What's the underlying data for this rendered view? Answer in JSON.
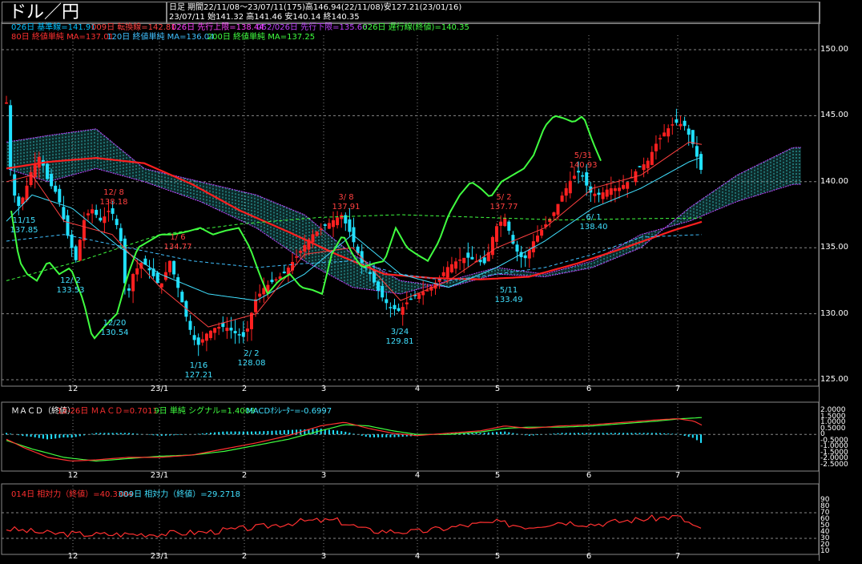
{
  "header": {
    "title": "ドル／円",
    "period_line": "日足  期間22/11/08〜23/07/11(175)高146.94(22/11/08)安127.21(23/01/16)",
    "last_line": "23/07/11          始141.32 高141.46 安140.14 終140.35"
  },
  "legend_row1": [
    {
      "text": "026日 基準線=141.91",
      "color": "#00c0ff"
    },
    {
      "text": "009日 転換線=142.81",
      "color": "#ff4040"
    },
    {
      "text": "026日 先行上限=138.44",
      "color": "#ff40ff"
    },
    {
      "text": "052/026日 先行下限=135.66",
      "color": "#c040ff"
    },
    {
      "text": "026日 遅行線(終値)=140.35",
      "color": "#40ff40"
    }
  ],
  "legend_row2": [
    {
      "text": "80日 終値単純 MA=137.01",
      "color": "#ff3030"
    },
    {
      "text": "120日 終値単純 MA=136.04",
      "color": "#40c0ff"
    },
    {
      "text": "200日 終値単純 MA=137.25",
      "color": "#40ff40"
    }
  ],
  "macd_legend": [
    {
      "text": "ＭＡＣＤ（終値）",
      "color": "#ffffff"
    },
    {
      "text": "12-26日 ＭＡＣＤ=0.7011",
      "color": "#ff3030"
    },
    {
      "text": "9日 単純 シグナル=1.4009",
      "color": "#40ff40"
    },
    {
      "text": "MACDｵｼﾚｰﾀｰ=-0.6997",
      "color": "#40e0ff"
    }
  ],
  "rsi_legend": [
    {
      "text": "014日 相対力（終値）=40.3384",
      "color": "#ff3030"
    },
    {
      "text": "009日 相対力（終値）=29.2718",
      "color": "#40e0ff"
    }
  ],
  "price_axis": [
    "150.00",
    "145.00",
    "140.00",
    "135.00",
    "130.00",
    "125.00"
  ],
  "macd_axis": [
    "2.0000",
    "1.5000",
    "1.0000",
    "0.5000",
    "0",
    "-0.5000",
    "-1.0000",
    "-1.5000",
    "-2.0000",
    "-2.5000"
  ],
  "rsi_axis": [
    "90",
    "80",
    "70",
    "60",
    "50",
    "40",
    "30",
    "20",
    "10"
  ],
  "x_labels": [
    "12",
    "23/1",
    "2",
    "3",
    "4",
    "5",
    "6",
    "7"
  ],
  "annotations": [
    {
      "date": "11/15",
      "value": "137.85",
      "color": "#40e0ff"
    },
    {
      "date": "12/ 2",
      "value": "133.53",
      "color": "#40e0ff"
    },
    {
      "date": "12/ 8",
      "value": "138.18",
      "color": "#ff4040"
    },
    {
      "date": "12/20",
      "value": "130.54",
      "color": "#40e0ff"
    },
    {
      "date": "1/ 6",
      "value": "134.77",
      "color": "#ff4040"
    },
    {
      "date": "1/16",
      "value": "127.21",
      "color": "#40e0ff"
    },
    {
      "date": "2/ 2",
      "value": "128.08",
      "color": "#40e0ff"
    },
    {
      "date": "3/ 8",
      "value": "137.91",
      "color": "#ff4040"
    },
    {
      "date": "3/24",
      "value": "129.81",
      "color": "#40e0ff"
    },
    {
      "date": "5/ 2",
      "value": "137.77",
      "color": "#ff4040"
    },
    {
      "date": "5/11",
      "value": "133.49",
      "color": "#40e0ff"
    },
    {
      "date": "5/31",
      "value": "140.93",
      "color": "#ff4040"
    },
    {
      "date": "6/ 1",
      "value": "138.40",
      "color": "#40e0ff"
    }
  ],
  "colors": {
    "up": "#ff2020",
    "down": "#20e0ff",
    "kumo": "#40e0e0",
    "kumo_edge": "#c040ff",
    "grid": "#888888"
  },
  "chart_data": [
    {
      "type": "candlestick",
      "title": "ドル／円",
      "ylim": [
        125,
        150
      ],
      "x_ticks": [
        "12",
        "23/1",
        "2",
        "3",
        "4",
        "5",
        "6",
        "7"
      ],
      "swing_points": [
        {
          "date": "11/15",
          "price": 137.85
        },
        {
          "date": "12/2",
          "price": 133.53
        },
        {
          "date": "12/8",
          "price": 138.18
        },
        {
          "date": "12/20",
          "price": 130.54
        },
        {
          "date": "1/6",
          "price": 134.77
        },
        {
          "date": "1/16",
          "price": 127.21
        },
        {
          "date": "2/2",
          "price": 128.08
        },
        {
          "date": "3/8",
          "price": 137.91
        },
        {
          "date": "3/24",
          "price": 129.81
        },
        {
          "date": "5/2",
          "price": 137.77
        },
        {
          "date": "5/11",
          "price": 133.49
        },
        {
          "date": "5/31",
          "price": 140.93
        },
        {
          "date": "6/1",
          "price": 138.4
        }
      ],
      "last_bar": {
        "date": "23/07/11",
        "open": 141.32,
        "high": 141.46,
        "low": 140.14,
        "close": 140.35
      },
      "period_high": {
        "date": "22/11/08",
        "price": 146.94
      },
      "period_low": {
        "date": "23/01/16",
        "price": 127.21
      },
      "ma_values": {
        "80": 137.01,
        "120": 136.04,
        "200": 137.25
      },
      "ichimoku": {
        "kijun": 141.91,
        "tenkan": 142.81,
        "senkou_a": 138.44,
        "senkou_b": 135.66,
        "chikou": 140.35
      }
    },
    {
      "type": "line",
      "title": "ＭＡＣＤ（終値）",
      "ylim": [
        -2.5,
        2.0
      ],
      "macd": 0.7011,
      "signal": 1.4009,
      "oscillator": -0.6997
    },
    {
      "type": "line",
      "title": "相対力（終値）",
      "ylim": [
        10,
        90
      ],
      "rsi14": 40.3384,
      "rsi9": 29.2718
    }
  ]
}
